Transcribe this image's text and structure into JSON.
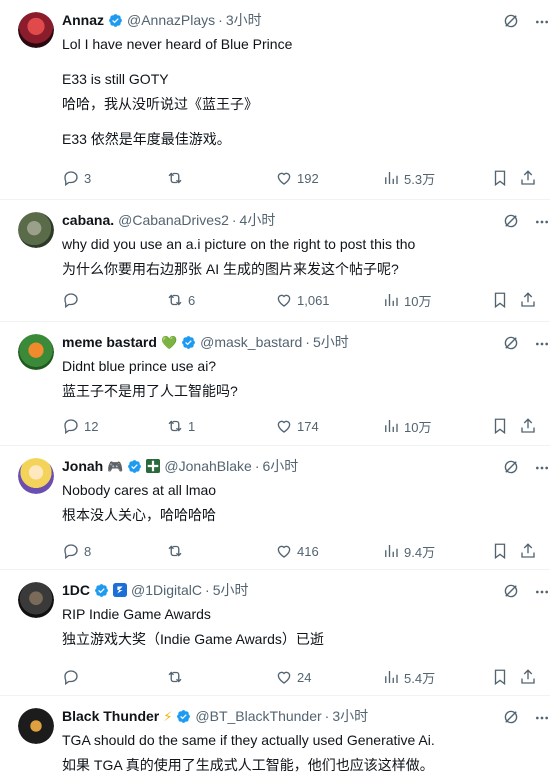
{
  "tweets": [
    {
      "name": "Annaz",
      "handle": "@AnnazPlays",
      "time": "3小时",
      "emoji": "",
      "lines": [
        "Lol I have never heard of Blue Prince",
        "E33 is still GOTY",
        "哈哈，我从没听说过《蓝王子》",
        "E33 依然是年度最佳游戏。"
      ],
      "replies": "3",
      "retweets": "",
      "likes": "192",
      "views": "5.3万",
      "avatar_color": "#8b1c2c"
    },
    {
      "name": "cabana.",
      "handle": "@CabanaDrives2",
      "time": "4小时",
      "emoji": "",
      "lines": [
        "why did you use an a.i picture on the right to post this tho",
        "为什么你要用右边那张 AI 生成的图片来发这个帖子呢?"
      ],
      "replies": "",
      "retweets": "6",
      "likes": "1,061",
      "views": "10万",
      "avatar_color": "#5a6b4a"
    },
    {
      "name": "meme bastard",
      "handle": "@mask_bastard",
      "time": "5小时",
      "emoji": "💚",
      "lines": [
        "Didnt blue prince use ai?",
        "蓝王子不是用了人工智能吗?"
      ],
      "replies": "12",
      "retweets": "1",
      "likes": "174",
      "views": "10万",
      "avatar_color": "#3a8a3a"
    },
    {
      "name": "Jonah",
      "handle": "@JonahBlake",
      "time": "6小时",
      "emoji": "🎮",
      "lines": [
        "Nobody cares at all lmao",
        "根本没人关心，哈哈哈哈"
      ],
      "replies": "8",
      "retweets": "",
      "likes": "416",
      "views": "9.4万",
      "avatar_color": "#f3d35a"
    },
    {
      "name": "1DC",
      "handle": "@1DigitalC",
      "time": "5小时",
      "emoji": "",
      "lines": [
        "RIP Indie Game Awards",
        "独立游戏大奖（Indie Game Awards）已逝"
      ],
      "replies": "",
      "retweets": "",
      "likes": "24",
      "views": "5.4万",
      "avatar_color": "#2b2b2b"
    },
    {
      "name": "Black Thunder",
      "handle": "@BT_BlackThunder",
      "time": "3小时",
      "emoji": "⚡",
      "lines": [
        "TGA should do the same if they actually used Generative Ai.",
        "如果 TGA 真的使用了生成式人工智能，他们也应该这样做。"
      ],
      "replies": "",
      "retweets": "",
      "likes": "",
      "views": "",
      "avatar_color": "#1c1c1c"
    }
  ],
  "icons": {
    "reply": "reply-icon",
    "retweet": "retweet-icon",
    "like": "like-icon",
    "views": "views-icon",
    "bookmark": "bookmark-icon",
    "share": "share-icon",
    "grok": "grok-icon",
    "more": "more-icon",
    "verified": "verified-badge-icon"
  },
  "colors": {
    "text": "#0f1419",
    "secondary": "#536471",
    "verified": "#1d9bf0",
    "divider": "#eff3f4"
  }
}
